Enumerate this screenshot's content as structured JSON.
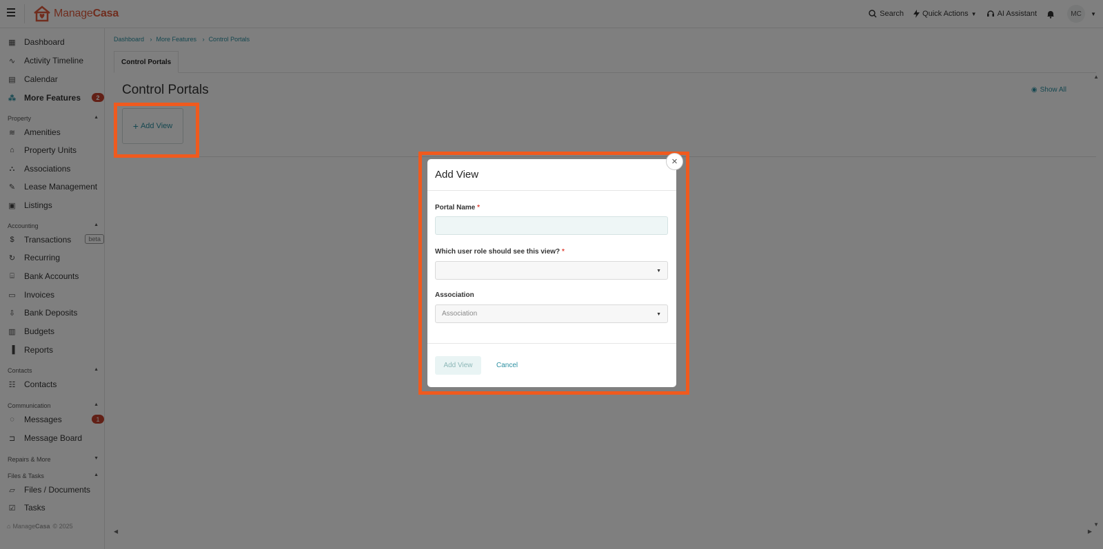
{
  "app": {
    "brand_light": "Manage",
    "brand_bold": "Casa",
    "brand_color": "#e05a3c",
    "accent": "#2a8fa0"
  },
  "header": {
    "search": "Search",
    "quick_actions": "Quick Actions",
    "ai_assistant": "AI Assistant",
    "avatar": "MC"
  },
  "sidebar": {
    "items": [
      {
        "label": "Dashboard",
        "icon": "dashboard-icon"
      },
      {
        "label": "Activity Timeline",
        "icon": "activity-icon"
      },
      {
        "label": "Calendar",
        "icon": "calendar-icon"
      },
      {
        "label": "More Features",
        "icon": "features-icon",
        "badge": "2"
      },
      {
        "label": "Amenities",
        "icon": "amenities-icon"
      },
      {
        "label": "Property Units",
        "icon": "home-icon"
      },
      {
        "label": "Associations",
        "icon": "associations-icon"
      },
      {
        "label": "Lease Management",
        "icon": "lease-icon"
      },
      {
        "label": "Listings",
        "icon": "listings-icon"
      },
      {
        "label": "Transactions",
        "icon": "transactions-icon",
        "tag": "beta"
      },
      {
        "label": "Recurring",
        "icon": "recurring-icon"
      },
      {
        "label": "Bank Accounts",
        "icon": "bank-icon"
      },
      {
        "label": "Invoices",
        "icon": "invoices-icon"
      },
      {
        "label": "Bank Deposits",
        "icon": "deposits-icon"
      },
      {
        "label": "Budgets",
        "icon": "budgets-icon"
      },
      {
        "label": "Reports",
        "icon": "reports-icon"
      },
      {
        "label": "Contacts",
        "icon": "contacts-icon"
      },
      {
        "label": "Messages",
        "icon": "messages-icon",
        "badge": "1"
      },
      {
        "label": "Message Board",
        "icon": "message-board-icon"
      },
      {
        "label": "Files / Documents",
        "icon": "folder-icon"
      },
      {
        "label": "Tasks",
        "icon": "tasks-icon"
      }
    ],
    "sections": {
      "property": "Property",
      "accounting": "Accounting",
      "contacts": "Contacts",
      "communication": "Communication",
      "repairs": "Repairs & More",
      "files": "Files & Tasks"
    },
    "footer": "© 2025"
  },
  "breadcrumb": [
    "Dashboard",
    "More Features",
    "Control Portals"
  ],
  "tabs": [
    "Control Portals"
  ],
  "page": {
    "title": "Control Portals",
    "show_all": "Show All",
    "add_view_card": "Add View"
  },
  "modal": {
    "title": "Add View",
    "portal_name_label": "Portal Name",
    "required_mark": "*",
    "portal_name_value": "",
    "role_label": "Which user role should see this view?",
    "role_value": "",
    "association_label": "Association",
    "association_placeholder": "Association",
    "submit": "Add View",
    "cancel": "Cancel",
    "close": "×"
  }
}
